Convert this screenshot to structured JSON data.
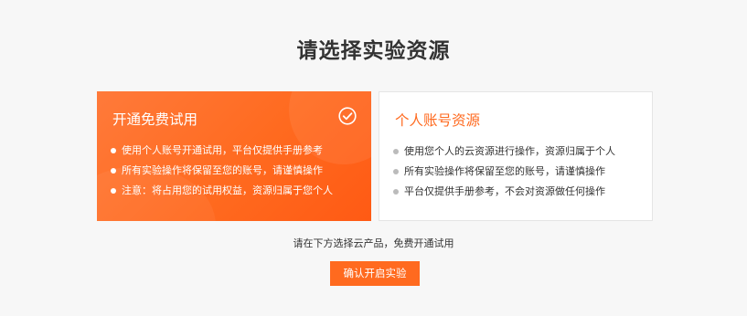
{
  "page": {
    "title": "请选择实验资源"
  },
  "cards": {
    "free": {
      "title": "开通免费试用",
      "selected": true,
      "icon": "check-circle-icon",
      "bullets": [
        "使用个人账号开通试用，平台仅提供手册参考",
        "所有实验操作将保留至您的账号，请谨慎操作",
        "注意：将占用您的试用权益，资源归属于您个人"
      ]
    },
    "personal": {
      "title": "个人账号资源",
      "selected": false,
      "bullets": [
        "使用您个人的云资源进行操作，资源归属于个人",
        "所有实验操作将保留至您的账号，请谨慎操作",
        "平台仅提供手册参考，不会对资源做任何操作"
      ]
    }
  },
  "hint": "请在下方选择云产品，免费开通试用",
  "confirm_button": "确认开启实验",
  "colors": {
    "accent": "#ff6a1f",
    "background": "#f7f7f7",
    "text": "#333333"
  }
}
